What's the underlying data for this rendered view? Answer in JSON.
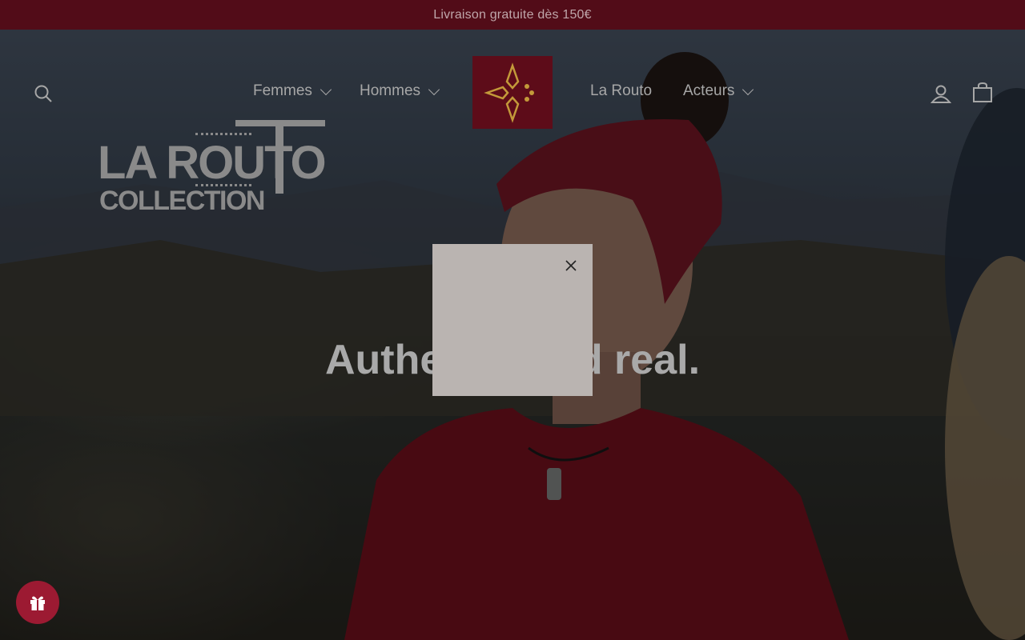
{
  "announcement": {
    "text": "Livraison gratuite dès 150€"
  },
  "header": {
    "nav_left": [
      {
        "label": "Femmes",
        "has_dropdown": true
      },
      {
        "label": "Hommes",
        "has_dropdown": true
      }
    ],
    "nav_right": [
      {
        "label": "La Routo",
        "has_dropdown": false
      },
      {
        "label": "Acteurs",
        "has_dropdown": true
      }
    ],
    "icons": {
      "search": "search-icon",
      "account": "account-icon",
      "cart": "cart-icon",
      "logo": "logo-cross-icon"
    }
  },
  "hero": {
    "brand_line1": "LA ROUTO",
    "brand_line2": "COLLECTION",
    "headline": "Authentic and real."
  },
  "modal": {
    "close_icon": "close-icon"
  },
  "gift_button": {
    "icon": "gift-icon"
  },
  "colors": {
    "announcement_bg": "#520c18",
    "logo_bg": "#5d0c19",
    "logo_accent": "#c39a3a",
    "modal_bg": "#bab4b1",
    "gift_bg": "#9c1a32"
  }
}
